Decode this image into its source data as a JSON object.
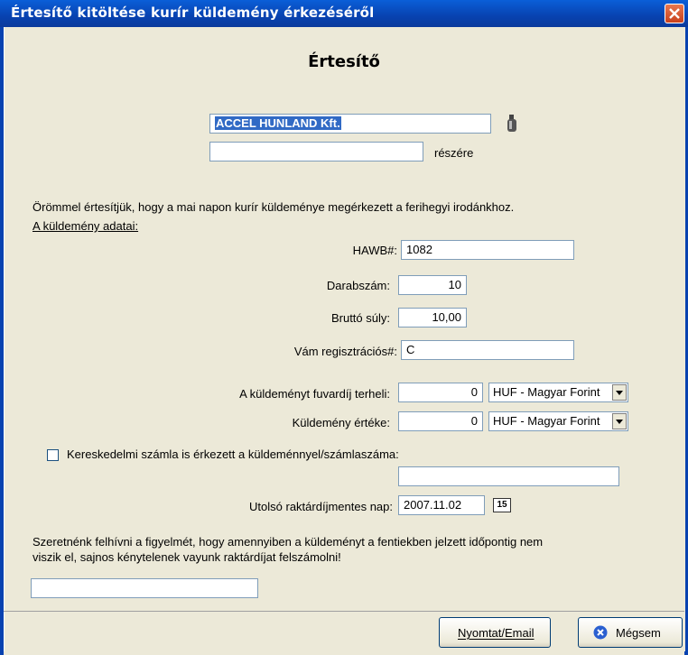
{
  "window": {
    "title": "Értesítő kitöltése kurír küldemény érkezéséről"
  },
  "heading": "Értesítő",
  "recipient": {
    "company": "ACCEL HUNLAND Kft.",
    "second_line": "",
    "suffix": "részére"
  },
  "intro": {
    "text": "Örömmel értesítjük, hogy a mai napon kurír küldeménye megérkezett a ferihegyi irodánkhoz.",
    "section_title": "A küldemény adatai:"
  },
  "fields": {
    "hawb_label": "HAWB#:",
    "hawb_value": "1082",
    "pieces_label": "Darabszám:",
    "pieces_value": "10",
    "weight_label": "Bruttó súly:",
    "weight_value": "10,00",
    "customs_label": "Vám regisztrációs#:",
    "customs_value": "C",
    "freight_label": "A küldeményt fuvardíj terheli:",
    "freight_value": "0",
    "freight_currency": "HUF - Magyar Forint",
    "value_label": "Küldemény értéke:",
    "value_value": "0",
    "value_currency": "HUF - Magyar Forint",
    "invoice_label": "Kereskedelmi számla is érkezett a küldeménnyel/számlaszáma:",
    "invoice_checked": false,
    "invoice_value": "",
    "lastday_label": "Utolsó raktárdíjmentes nap:",
    "lastday_value": "2007.11.02",
    "calendar_icon_text": "15"
  },
  "notice": {
    "line1": "Szeretnénk felhívni a figyelmét, hogy amennyiben a küldeményt a fentiekben jelzett időpontig nem",
    "line2": "viszik el, sajnos kénytelenek vayunk raktárdíjat felszámolni!",
    "extra_value": ""
  },
  "buttons": {
    "print_label": "Nyomtat/Email",
    "cancel_label": "Mégsem"
  },
  "colors": {
    "titlebar": "#0842b0",
    "selection": "#316ac5",
    "close": "#d8542a"
  }
}
